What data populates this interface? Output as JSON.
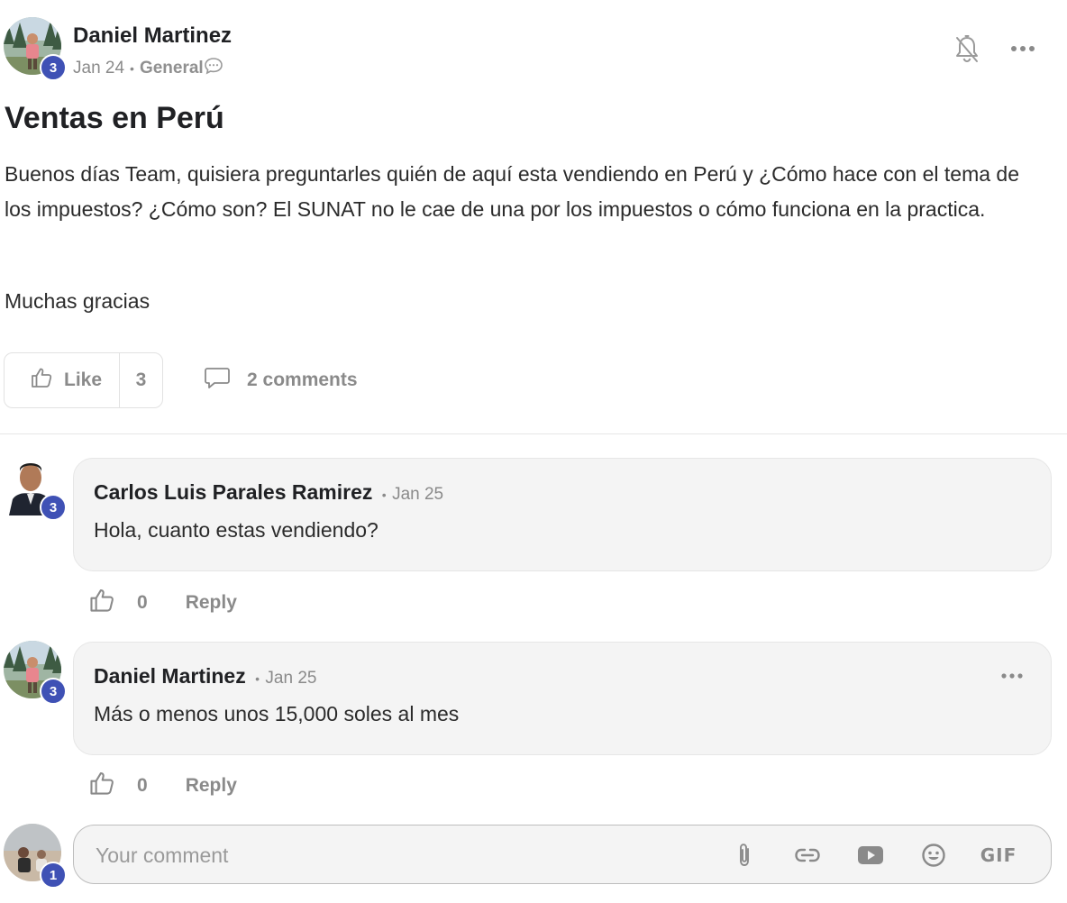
{
  "post": {
    "author": "Daniel Martinez",
    "author_level": "3",
    "date": "Jan 24",
    "separator": "•",
    "category": "General",
    "title": "Ventas en Perú",
    "body_paragraph_1": "Buenos días Team, quisiera preguntarles quién de aquí esta vendiendo en Perú y ¿Cómo hace con el tema de los impuestos? ¿Cómo son? El SUNAT no le cae de una por los impuestos o cómo funciona en la practica.",
    "body_paragraph_2": "Muchas gracias",
    "like_label": "Like",
    "like_count": "3",
    "comments_label": "2 comments"
  },
  "comments": [
    {
      "author": "Carlos Luis Parales Ramirez",
      "author_level": "3",
      "separator": "•",
      "date": "Jan 25",
      "text": "Hola, cuanto estas vendiendo?",
      "like_count": "0",
      "reply_label": "Reply"
    },
    {
      "author": "Daniel Martinez",
      "author_level": "3",
      "separator": "•",
      "date": "Jan 25",
      "text": "Más o menos unos 15,000 soles al mes",
      "like_count": "0",
      "reply_label": "Reply"
    }
  ],
  "composer": {
    "placeholder": "Your comment",
    "user_level": "1",
    "gif_label": "GIF"
  },
  "icons": {
    "notification": "bell-off-icon",
    "more": "more-horizontal-icon",
    "like": "thumbs-up-icon",
    "comment": "chat-bubble-icon",
    "attach": "paperclip-icon",
    "link": "link-icon",
    "video": "youtube-icon",
    "emoji": "smiley-icon"
  },
  "colors": {
    "badge": "#3f51b5",
    "muted": "#8a8a8a",
    "bubble_bg": "#f4f4f4"
  }
}
